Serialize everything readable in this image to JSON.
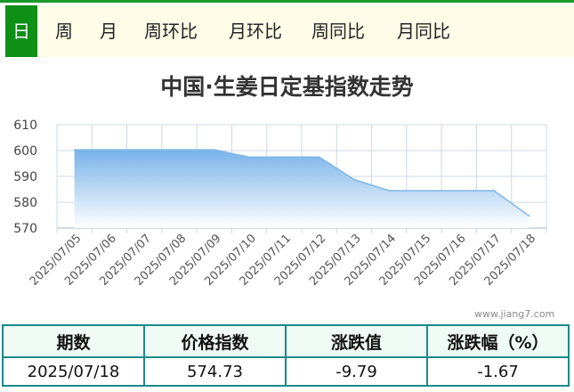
{
  "tabs": [
    {
      "label": "日",
      "active": true
    },
    {
      "label": "周",
      "active": false
    },
    {
      "label": "月",
      "active": false
    },
    {
      "label": "周环比",
      "active": false
    },
    {
      "label": "月环比",
      "active": false
    },
    {
      "label": "周同比",
      "active": false
    },
    {
      "label": "月同比",
      "active": false
    }
  ],
  "watermark": "www.jiang7.com",
  "chart_data": {
    "type": "area",
    "title": "中国·生姜日定基指数走势",
    "x": [
      "2025/07/05",
      "2025/07/06",
      "2025/07/07",
      "2025/07/08",
      "2025/07/09",
      "2025/07/10",
      "2025/07/11",
      "2025/07/12",
      "2025/07/13",
      "2025/07/14",
      "2025/07/15",
      "2025/07/16",
      "2025/07/17",
      "2025/07/18"
    ],
    "values": [
      600.3,
      600.3,
      600.3,
      600.3,
      600.3,
      597.5,
      597.5,
      597.5,
      588.8,
      584.5,
      584.5,
      584.5,
      584.5,
      574.73
    ],
    "ylim": [
      570,
      610
    ],
    "yticks": [
      "610",
      "600",
      "590",
      "580",
      "570"
    ],
    "grid": true,
    "colors": {
      "line": "#7fb6e8",
      "fill_top": "#78b2ea",
      "fill_bottom": "#ffffff",
      "grid": "#cfd8e4"
    }
  },
  "table": {
    "headers": [
      "期数",
      "价格指数",
      "涨跌值",
      "涨跌幅（%）"
    ],
    "row": [
      "2025/07/18",
      "574.73",
      "-9.79",
      "-1.67"
    ]
  }
}
